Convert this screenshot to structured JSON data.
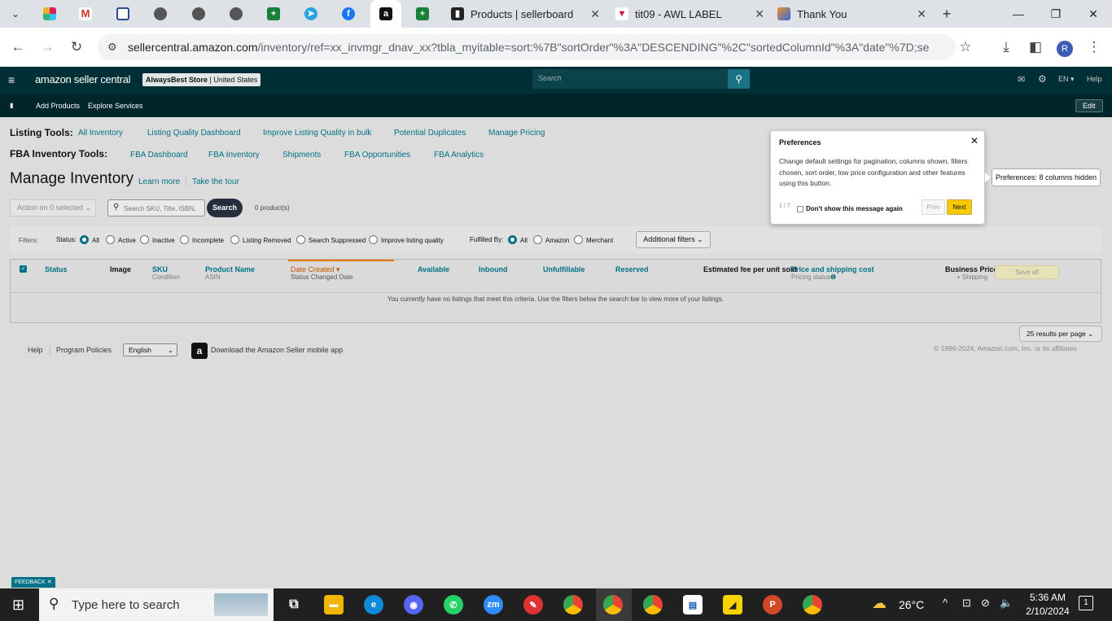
{
  "browser": {
    "tabs": [
      {
        "label": "Products | sellerboard",
        "icon": "sellerboard-icon"
      },
      {
        "label": "tit09 - AWL LABEL",
        "icon": "awl-label-icon"
      },
      {
        "label": "Thank You",
        "icon": "thank-you-icon"
      }
    ],
    "url_domain": "sellercentral.amazon.com",
    "url_path": "/inventory/ref=xx_invmgr_dnav_xx?tbla_myitable=sort:%7B\"sortOrder\"%3A\"DESCENDING\"%2C\"sortedColumnId\"%3A\"date\"%7D;sea...",
    "profile_initial": "R"
  },
  "header": {
    "logo": "amazon seller central",
    "store_name": "AlwaysBest Store",
    "store_region": "United States",
    "search_placeholder": "Search",
    "language": "EN",
    "help": "Help"
  },
  "subnav": {
    "items": [
      "Add Products",
      "Explore Services"
    ],
    "edit": "Edit"
  },
  "listing_tools": {
    "label": "Listing Tools:",
    "links": [
      "All Inventory",
      "Listing Quality Dashboard",
      "Improve Listing Quality in bulk",
      "Potential Duplicates",
      "Manage Pricing"
    ]
  },
  "fba_tools": {
    "label": "FBA Inventory Tools:",
    "links": [
      "FBA Dashboard",
      "FBA Inventory",
      "Shipments",
      "FBA Opportunities",
      "FBA Analytics"
    ]
  },
  "page": {
    "title": "Manage Inventory",
    "learn_more": "Learn more",
    "take_tour": "Take the tour",
    "action_select": "Action on 0 selected",
    "search_placeholder": "Search SKU, Title, ISBN,",
    "search_button": "Search",
    "product_count": "0 product(s)"
  },
  "filters": {
    "label": "Filters:",
    "status_label": "Status:",
    "status_options": [
      "All",
      "Active",
      "Inactive",
      "Incomplete",
      "Listing Removed",
      "Search Suppressed",
      "Improve listing quality"
    ],
    "fulfilled_label": "Fulfilled By:",
    "fulfilled_options": [
      "All",
      "Amazon",
      "Merchant"
    ],
    "additional": "Additional filters"
  },
  "table": {
    "columns": [
      {
        "main": "Status",
        "sub": ""
      },
      {
        "main": "Image",
        "sub": ""
      },
      {
        "main": "SKU",
        "sub": "Condition"
      },
      {
        "main": "Product Name",
        "sub": "ASIN"
      },
      {
        "main": "Date Created",
        "sub": "Status Changed Date"
      },
      {
        "main": "Available",
        "sub": ""
      },
      {
        "main": "Inbound",
        "sub": ""
      },
      {
        "main": "Unfulfillable",
        "sub": ""
      },
      {
        "main": "Reserved",
        "sub": ""
      },
      {
        "main": "Estimated fee per unit sold",
        "sub": ""
      },
      {
        "main": "Price and shipping cost",
        "sub": "Pricing status"
      },
      {
        "main": "Business Price",
        "sub": "+ Shipping"
      }
    ],
    "save_all": "Save all",
    "empty_message": "You currently have no listings that meet this criteria. Use the filters below the search bar to view more of your listings.",
    "per_page": "25 results per page"
  },
  "popover": {
    "title": "Preferences",
    "body": "Change default settings for pagination, columns shown, filters chosen, sort order, low price configuration and other features using this button.",
    "step": "1 / 7",
    "dont_show": "Don't show this message again",
    "prev": "Prev",
    "next": "Next"
  },
  "tooltip": "Preferences: 8 columns hidden",
  "footer": {
    "help": "Help",
    "policies": "Program Policies",
    "language": "English",
    "app": "Download the Amazon Seller mobile app",
    "copyright": "© 1999-2024, Amazon.com, Inc. or its affiliates"
  },
  "feedback": "FEEDBACK",
  "taskbar": {
    "search_placeholder": "Type here to search",
    "weather": "26°C",
    "time": "5:36 AM",
    "date": "2/10/2024",
    "notifications": "1"
  },
  "colors": {
    "amazon_header": "#002f36",
    "link": "#007185",
    "next_button": "#f7ca00"
  }
}
